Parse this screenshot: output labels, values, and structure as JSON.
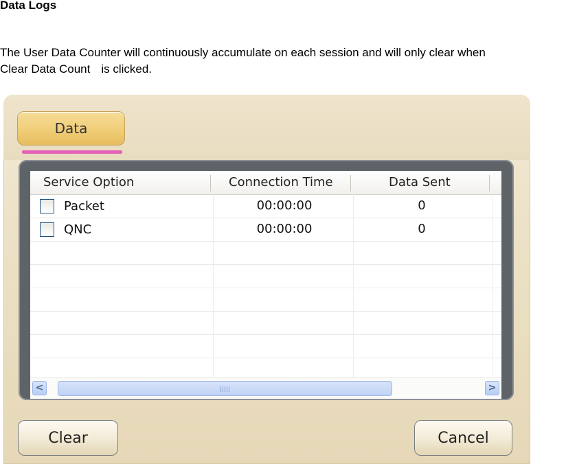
{
  "document": {
    "heading": "Data Logs",
    "line1": "The User Data Counter will continuously accumulate on each session and will only clear when",
    "line2_a": "Clear Data Count",
    "line2_b": "is clicked."
  },
  "dialog": {
    "tab_label": "Data",
    "table": {
      "columns": [
        "Service Option",
        "Connection Time",
        "Data Sent"
      ],
      "rows": [
        {
          "service": "Packet",
          "checked": false,
          "time": "00:00:00",
          "sent": "0"
        },
        {
          "service": "QNC",
          "checked": false,
          "time": "00:00:00",
          "sent": "0"
        }
      ],
      "scrollbar_grip": "III"
    },
    "buttons": {
      "clear": "Clear",
      "cancel": "Cancel"
    }
  },
  "colors": {
    "tab_gold": "#f1cf7b",
    "tab_underline": "#e563b8",
    "panel_gray": "#5e6368",
    "scroll_blue": "#c0d3f5"
  }
}
